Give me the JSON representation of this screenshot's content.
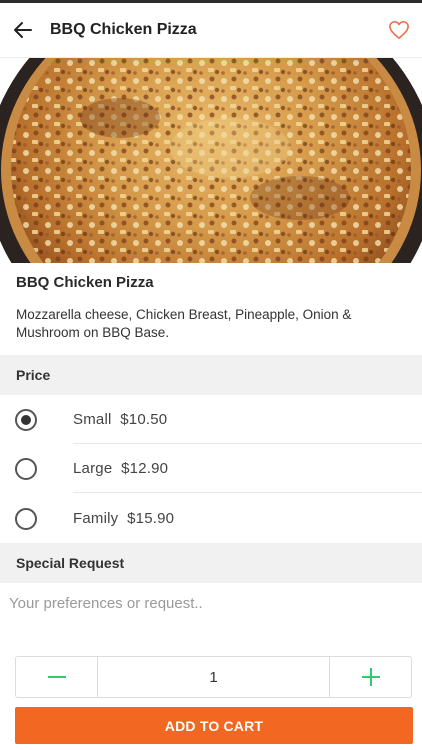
{
  "header": {
    "title": "BBQ Chicken Pizza",
    "back_icon": "arrow-left-icon",
    "favorite_icon": "heart-outline-icon"
  },
  "product": {
    "image": "pizza-photo",
    "name": "BBQ Chicken Pizza",
    "description": "Mozzarella cheese, Chicken Breast, Pineapple, Onion & Mushroom on BBQ Base."
  },
  "price_section": {
    "title": "Price",
    "options": [
      {
        "size": "Small",
        "price": "$10.50",
        "selected": true
      },
      {
        "size": "Large",
        "price": "$12.90",
        "selected": false
      },
      {
        "size": "Family",
        "price": "$15.90",
        "selected": false
      }
    ]
  },
  "request_section": {
    "title": "Special Request",
    "placeholder": "Your preferences or request..",
    "value": ""
  },
  "quantity": {
    "value": "1",
    "minus_icon": "minus-icon",
    "plus_icon": "plus-icon"
  },
  "actions": {
    "add_to_cart_label": "ADD TO CART"
  },
  "colors": {
    "accent": "#f26722",
    "stepper_green": "#2ecc71",
    "heart": "#e8734a"
  }
}
